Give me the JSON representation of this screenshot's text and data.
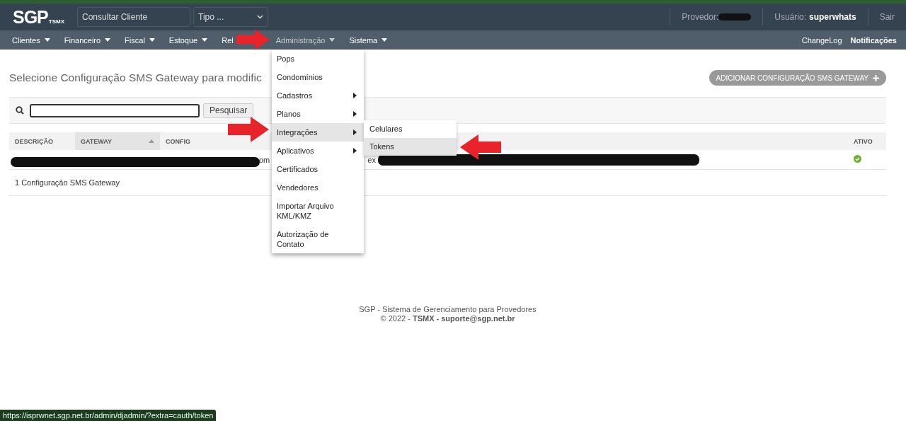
{
  "header": {
    "logo": "SGP",
    "logo_sub": "TSMX",
    "search": {
      "placeholder": "Consultar Cliente"
    },
    "type_select": "Tipo ...",
    "provider_label": "Provedor:",
    "user_label": "Usuário:",
    "user": "superwhats",
    "logout": "Sair"
  },
  "nav": {
    "items": [
      {
        "label": "Clientes",
        "selected": false
      },
      {
        "label": "Financeiro",
        "selected": false
      },
      {
        "label": "Fiscal",
        "selected": false
      },
      {
        "label": "Estoque",
        "selected": false
      },
      {
        "label": "Rel",
        "selected": false,
        "caret": false
      },
      {
        "label": "Administração",
        "selected": true
      },
      {
        "label": "Sistema",
        "selected": false
      }
    ],
    "right": [
      {
        "label": "ChangeLog",
        "bold": false
      },
      {
        "label": "Notificações",
        "bold": true
      }
    ]
  },
  "menu": {
    "items": [
      {
        "label": "Pops",
        "submenu": false,
        "selected": false
      },
      {
        "label": "Condomínios",
        "submenu": false,
        "selected": false
      },
      {
        "label": "Cadastros",
        "submenu": true,
        "selected": false
      },
      {
        "label": "Planos",
        "submenu": true,
        "selected": false
      },
      {
        "label": "Integrações",
        "submenu": true,
        "selected": true
      },
      {
        "label": "Aplicativos",
        "submenu": true,
        "selected": false
      },
      {
        "label": "Certificados",
        "submenu": false,
        "selected": false
      },
      {
        "label": "Vendedores",
        "submenu": false,
        "selected": false
      },
      {
        "label": "Importar Arquivo KML/KMZ",
        "submenu": false,
        "selected": false
      },
      {
        "label": "Autorização de Contato",
        "submenu": false,
        "selected": false
      }
    ],
    "submenu": [
      {
        "label": "Celulares",
        "selected": false
      },
      {
        "label": "Tokens",
        "selected": true
      }
    ]
  },
  "page": {
    "title": "Selecione Configuração SMS Gateway para modific",
    "add_button": "ADICIONAR CONFIGURAÇÃO SMS GATEWAY",
    "search_button": "Pesquisar"
  },
  "table": {
    "columns": [
      {
        "label": "DESCRIÇÃO",
        "sorted": false
      },
      {
        "label": "GATEWAY",
        "sorted": true
      },
      {
        "label": "CONFIG",
        "sorted": false
      },
      {
        "label": "ATIVO",
        "sorted": false
      }
    ],
    "rows": [
      {
        "config_fragments": [
          "om",
          "ex"
        ],
        "active": true
      }
    ],
    "count": "1 Configuração SMS Gateway"
  },
  "footer": {
    "line1": "SGP - Sistema de Gerenciamento para Provedores",
    "line2": "© 2022 - **TSMX - suporte@sgp.net.br**"
  },
  "status_url": "https://isprwnet.sgp.net.br/admin/djadmin/?extra=cauth/token"
}
